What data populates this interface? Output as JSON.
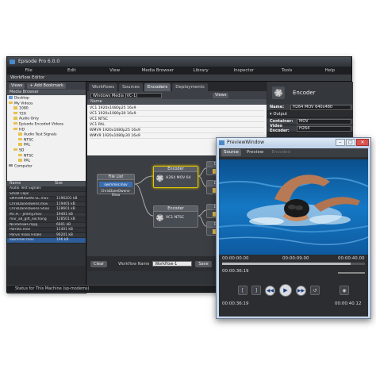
{
  "app": {
    "title": "Episode Pro 6.0.0",
    "menu": [
      "File",
      "Edit",
      "View",
      "Media Browser",
      "Library",
      "Inspector",
      "Tools",
      "Help"
    ],
    "workflow_editor_label": "Workflow Editor"
  },
  "media_browser": {
    "views_label": "Views",
    "add_bookmark_label": "+ Add Bookmark",
    "header": "Media Browser",
    "tree": [
      "Desktop",
      "My Videos",
      "1080",
      "720",
      "Audio Only",
      "Episode Encoded Videos",
      "HD",
      "Audio Test Signals",
      "NTSC",
      "PAL",
      "SD",
      "NTSC",
      "PAL",
      "Computer"
    ],
    "file_columns": [
      "Name",
      "Size"
    ],
    "files": [
      {
        "name": "Audio Test Signals",
        "size": ""
      },
      {
        "name": "Small Clips",
        "size": ""
      },
      {
        "name": "SMmdMXSRNTSC.mov",
        "size": "1196201 kB"
      },
      {
        "name": "ChrisDaneOwens.mov",
        "size": "119401 kB"
      },
      {
        "name": "ChrisDaneOwens-Shoo",
        "size": "128601 kB"
      },
      {
        "name": "M.I.A. - Jimmy.mov",
        "size": "19401 kB"
      },
      {
        "name": "mar_ad_gift_exchang",
        "size": "128501 kB"
      },
      {
        "name": "NiceShows.mpg",
        "size": "6601 kB"
      },
      {
        "name": "Parrots.mov",
        "size": "12401 kB"
      },
      {
        "name": "Parvis Visso Finale",
        "size": "96201 kB"
      },
      {
        "name": "swimmer.mov",
        "size": "196 kB"
      }
    ]
  },
  "center": {
    "tabs": [
      "Workflows",
      "Sources",
      "Encoders",
      "Deployments"
    ],
    "format_select": "Windows Media (VC-1)",
    "views_label": "Views",
    "table_header": "Name",
    "encoders": [
      "VC1 1920x1080p25 16x9",
      "VC1 1920x1080p30 16x9",
      "VC1 NTSC",
      "VC1 PAL",
      "WMV9 1920x1080p25 16x9",
      "WMV9 1920x1080p30 16x9"
    ],
    "nodes": {
      "file_list_title": "File List",
      "file_list_item1": "swimmer.mov",
      "file_list_item2": "ChrisDaneOwens-Shoo",
      "encoder_title": "Encoder",
      "encoder_label": "H264 MOV 64",
      "encoder2_label": "VC1 NTSC",
      "deploy_label": "De"
    },
    "clear_label": "Clear",
    "workflow_name_label": "Workflow Name",
    "workflow_name_value": "Workflow-1",
    "save_label": "Save"
  },
  "inspector": {
    "title": "Encoder",
    "name_label": "Name:",
    "name_value": "H264 MOV 640x480",
    "output_label": "Output",
    "container_label": "Container:",
    "container_value": "MOV",
    "video_encoder_label": "Video Encoder:",
    "video_encoder_value": "H264"
  },
  "preview": {
    "title": "PreviewWindow",
    "tabs": [
      "Source",
      "Preview",
      "Encoded"
    ],
    "start_tc": "00:00:00.00",
    "mid_tc": "00:00:09.00",
    "end_tc": "00:00:40.00",
    "position_tc": "00:00:36:19",
    "bottom_tc": "00:00:36:19",
    "duration_tc": "00:00:40.12",
    "playhead_fraction": 0.9
  },
  "status_bar": "Status for This Machine (sp-modems)"
}
